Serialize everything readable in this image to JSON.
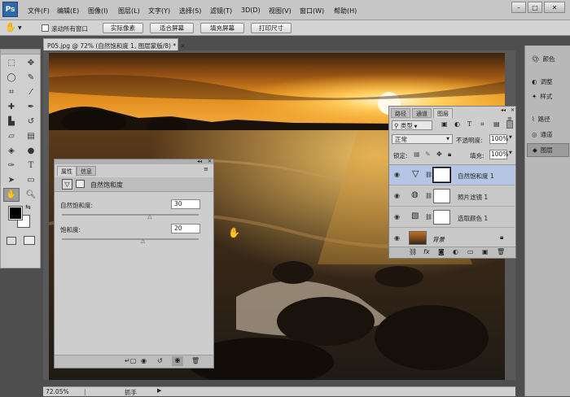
{
  "app": {
    "logo": "Ps"
  },
  "menu": [
    "文件(F)",
    "编辑(E)",
    "图像(I)",
    "图层(L)",
    "文字(Y)",
    "选择(S)",
    "滤镜(T)",
    "3D(D)",
    "视图(V)",
    "窗口(W)",
    "帮助(H)"
  ],
  "window_controls": {
    "minimize": "–",
    "restore": "□",
    "close": "✕"
  },
  "options": {
    "scroll_all_label": "滚动所有窗口",
    "buttons": [
      "实际像素",
      "适合屏幕",
      "填充屏幕",
      "打印尺寸"
    ]
  },
  "document": {
    "tab_title": "P05.jpg @ 72% (自然饱和度 1, 图层蒙版/8) *",
    "tab_close": "×"
  },
  "status": {
    "zoom": "72.05%",
    "tool": "抓手"
  },
  "right_dock": [
    "颜色",
    "调整",
    "样式",
    "路径",
    "通道",
    "图层"
  ],
  "properties": {
    "tabs": [
      "属性",
      "信息"
    ],
    "title": "自然饱和度",
    "vibrance_label": "自然饱和度:",
    "vibrance_value": "30",
    "saturation_label": "饱和度:",
    "saturation_value": "20",
    "vibrance_fraction": 0.65,
    "saturation_fraction": 0.6
  },
  "layers_panel": {
    "tabs": [
      "路径",
      "通道",
      "图层"
    ],
    "filter_kind": "类型",
    "blend_mode": "正常",
    "opacity_label": "不透明度:",
    "opacity_value": "100%",
    "lock_label": "锁定:",
    "fill_label": "填充:",
    "fill_value": "100%",
    "layers": [
      {
        "name": "自然饱和度 1",
        "selected": true
      },
      {
        "name": "照片滤镜 1",
        "selected": false
      },
      {
        "name": "选取颜色 1",
        "selected": false
      },
      {
        "name": "背景",
        "selected": false
      }
    ]
  }
}
